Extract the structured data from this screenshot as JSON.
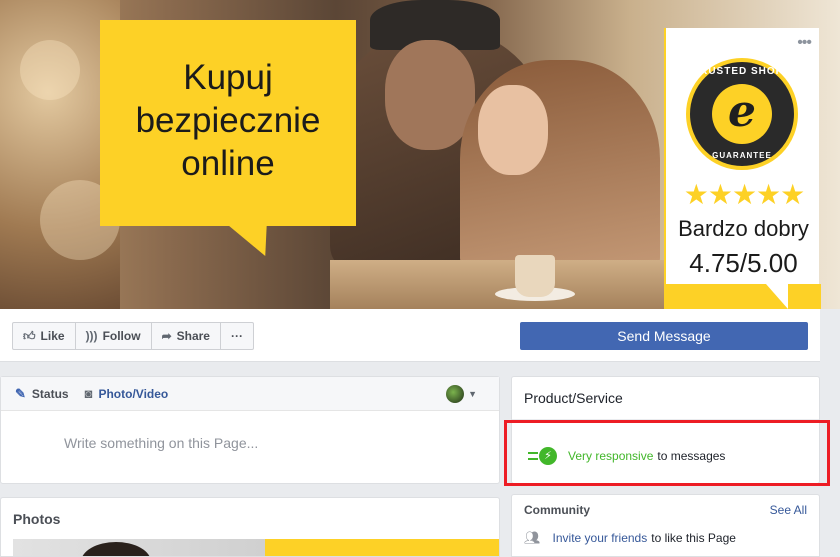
{
  "cover": {
    "bubble_text": "Kupuj\nbezpiecznie\nonline",
    "trusted_shops": {
      "seal_top": "TRUSTED SHOPS",
      "seal_letter": "e",
      "seal_bottom": "GUARANTEE",
      "stars": "★★★★★",
      "rating_label": "Bardzo dobry",
      "score": "4.75/5.00",
      "menu_dots": "•••"
    }
  },
  "actions": {
    "like": "Like",
    "follow": "Follow",
    "share": "Share",
    "more": "···",
    "send_message": "Send Message"
  },
  "composer": {
    "status_tab": "Status",
    "photo_video_tab": "Photo/Video",
    "placeholder": "Write something on this Page..."
  },
  "photos": {
    "title": "Photos"
  },
  "about": {
    "category": "Product/Service",
    "responsiveness_highlight": "Very responsive",
    "responsiveness_rest": "to messages"
  },
  "community": {
    "title": "Community",
    "see_all": "See All",
    "invite_link": "Invite your friends",
    "invite_rest": "to like this Page"
  },
  "colors": {
    "brand_yellow": "#fdd126",
    "fb_blue": "#4267b2",
    "responsive_green": "#42b72a",
    "highlight_red": "#ed1c24"
  }
}
